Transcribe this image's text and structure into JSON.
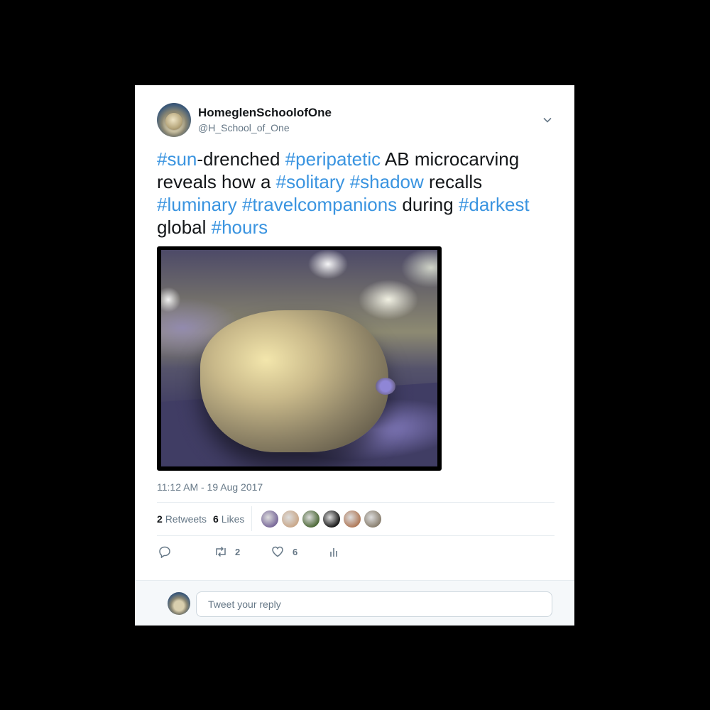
{
  "author": {
    "display_name": "HomeglenSchoolofOne",
    "handle": "@H_School_of_One"
  },
  "tweet": {
    "segments": [
      {
        "text": "#sun",
        "hashtag": true
      },
      {
        "text": "-drenched ",
        "hashtag": false
      },
      {
        "text": "#peripatetic",
        "hashtag": true
      },
      {
        "text": " AB microcarving reveals how a ",
        "hashtag": false
      },
      {
        "text": "#solitary",
        "hashtag": true
      },
      {
        "text": " ",
        "hashtag": false
      },
      {
        "text": "#shadow",
        "hashtag": true
      },
      {
        "text": " recalls ",
        "hashtag": false
      },
      {
        "text": "#luminary",
        "hashtag": true
      },
      {
        "text": " ",
        "hashtag": false
      },
      {
        "text": "#travelcompanions",
        "hashtag": true
      },
      {
        "text": " during ",
        "hashtag": false
      },
      {
        "text": "#darkest",
        "hashtag": true
      },
      {
        "text": " global ",
        "hashtag": false
      },
      {
        "text": "#hours",
        "hashtag": true
      }
    ],
    "timestamp": "11:12 AM - 19 Aug 2017"
  },
  "stats": {
    "retweets_count": "2",
    "retweets_label": "Retweets",
    "likes_count": "6",
    "likes_label": "Likes"
  },
  "likers": [
    {
      "name": "liker-avatar-1",
      "color": "#7a6a9a"
    },
    {
      "name": "liker-avatar-2",
      "color": "#c9a88a"
    },
    {
      "name": "liker-avatar-3",
      "color": "#4f6b3a"
    },
    {
      "name": "liker-avatar-4",
      "color": "#1a1a1a"
    },
    {
      "name": "liker-avatar-5",
      "color": "#b07a5a"
    },
    {
      "name": "liker-avatar-6",
      "color": "#8a8070"
    }
  ],
  "actions": {
    "reply_count": "",
    "retweet_count": "2",
    "like_count": "6"
  },
  "reply": {
    "placeholder": "Tweet your reply"
  },
  "colors": {
    "hashtag": "#3a94e0",
    "text": "#14171a",
    "muted": "#657786"
  }
}
